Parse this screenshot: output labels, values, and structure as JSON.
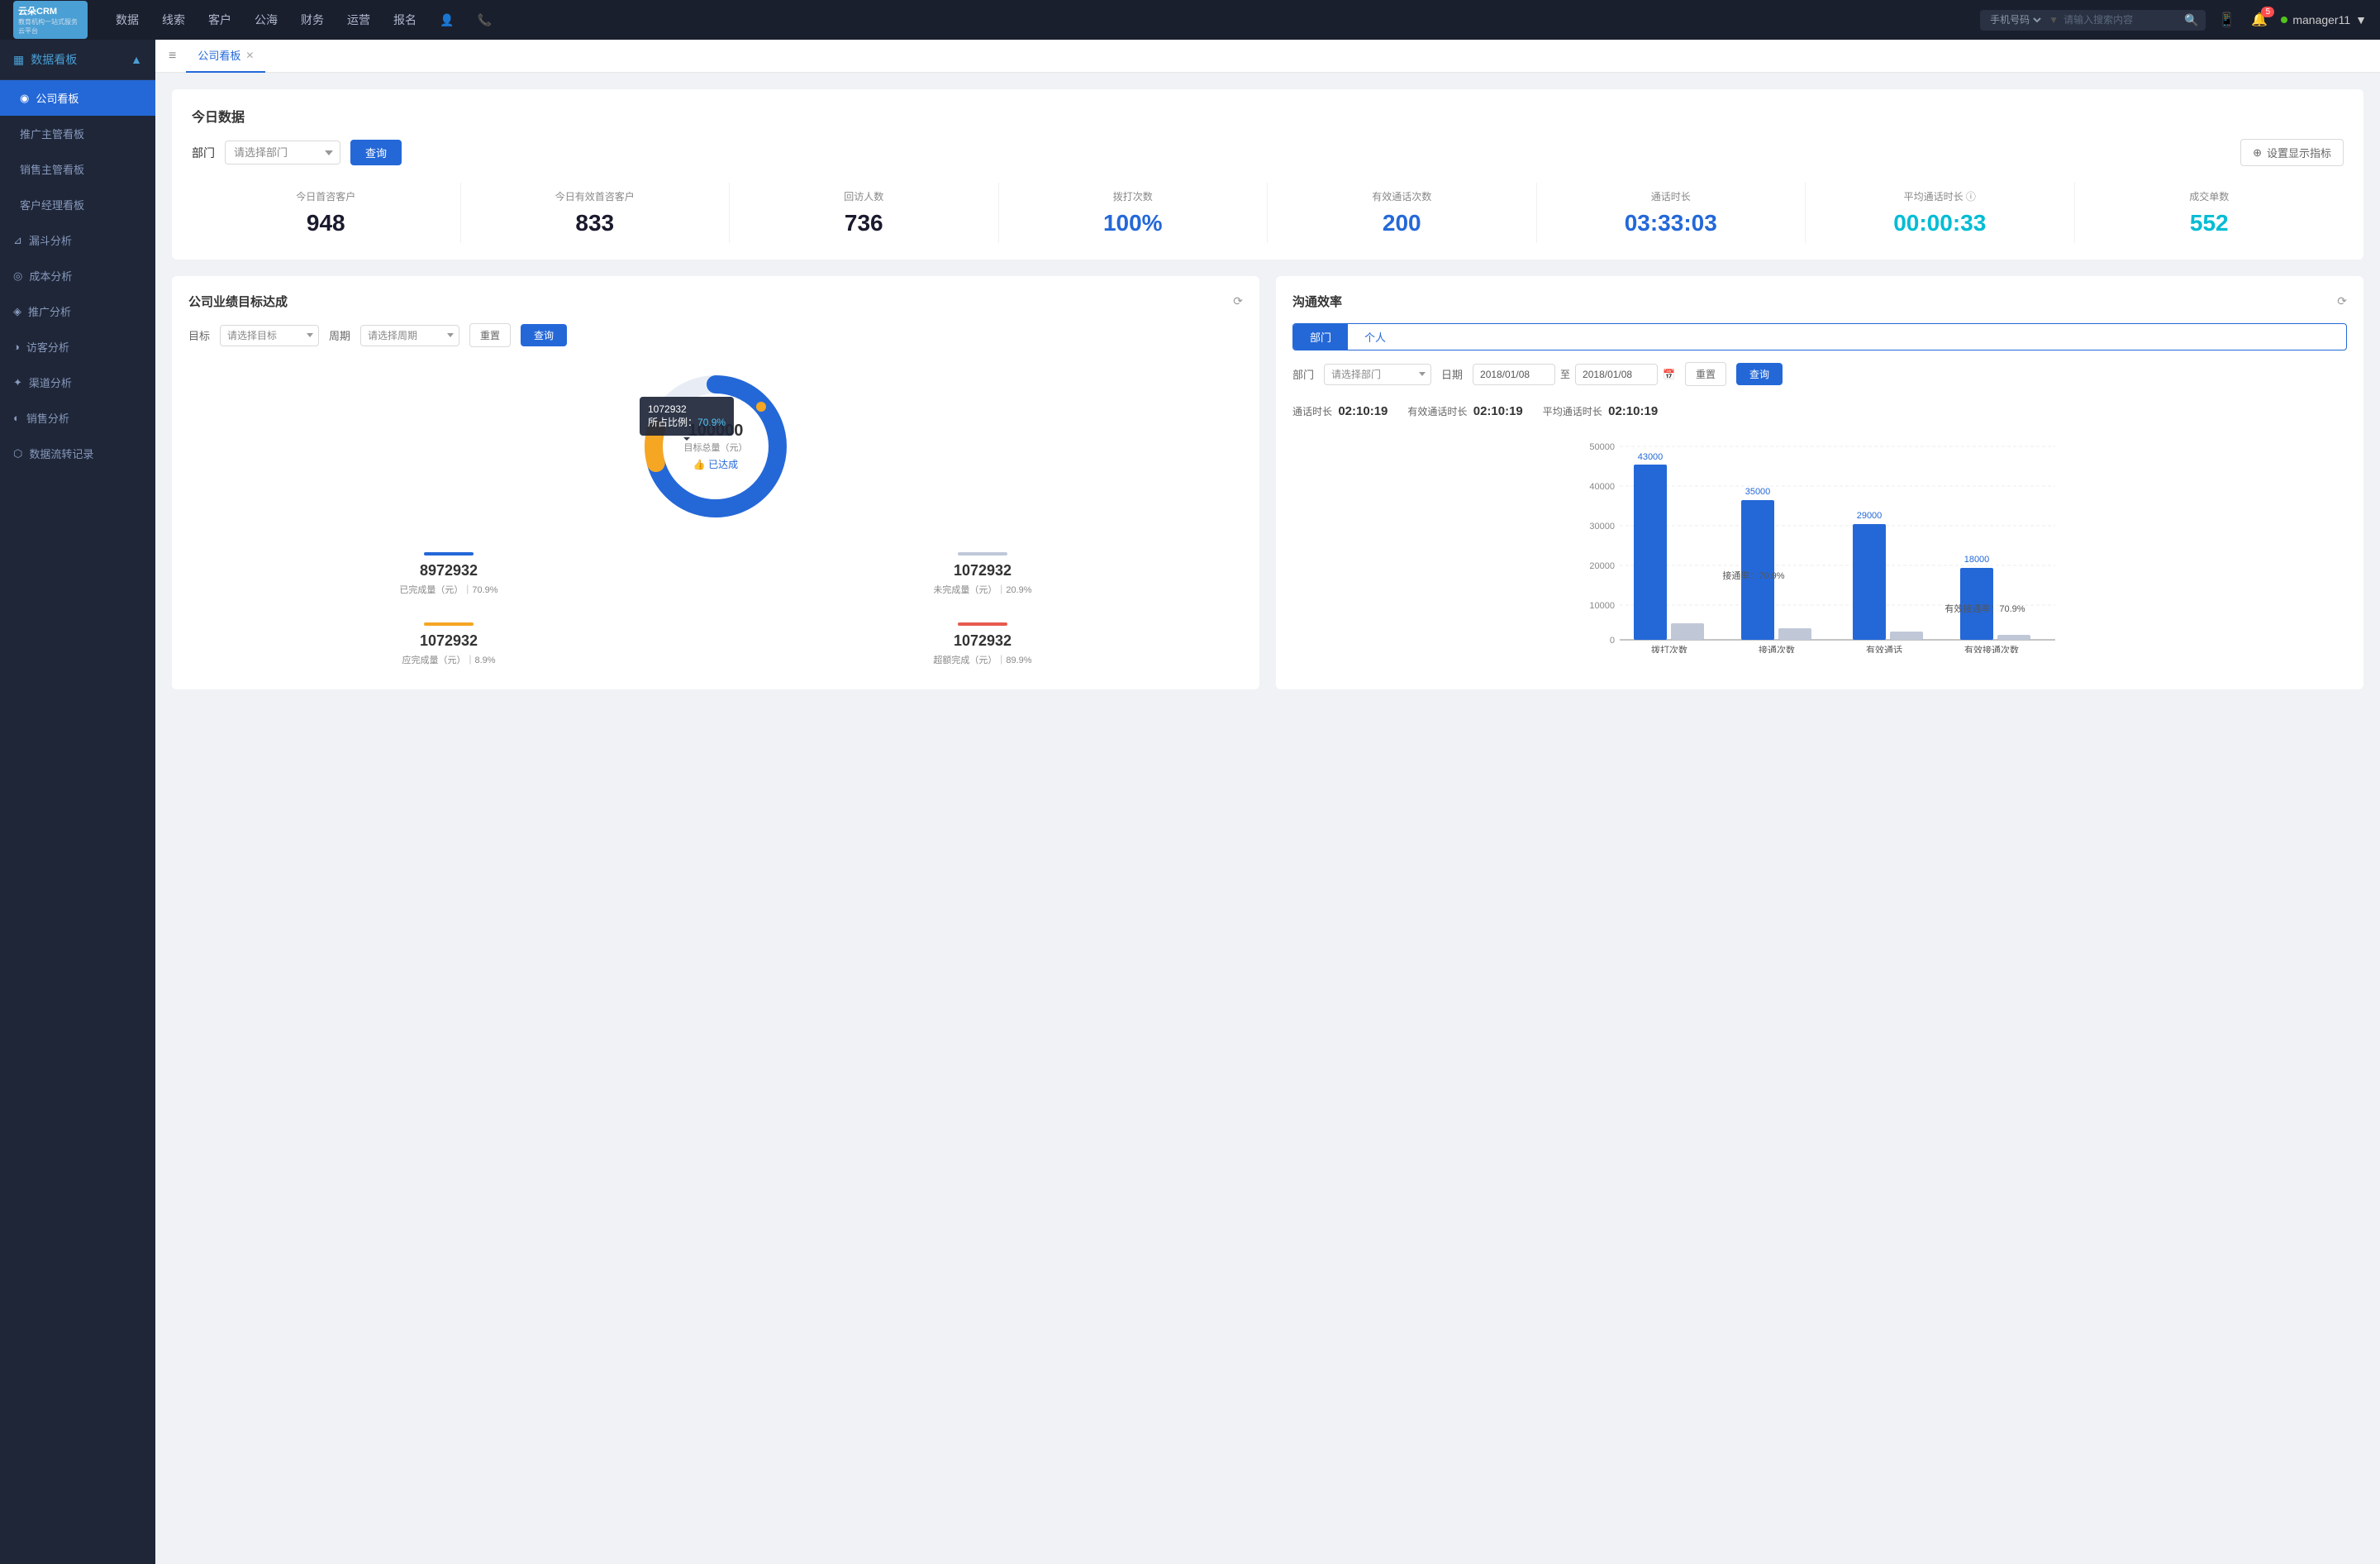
{
  "app": {
    "logo_top": "云朵CRM",
    "logo_bottom": "教育机构一站式服务云平台"
  },
  "nav": {
    "items": [
      "数据",
      "线索",
      "客户",
      "公海",
      "财务",
      "运营",
      "报名"
    ]
  },
  "search": {
    "placeholder": "请输入搜索内容",
    "option": "手机号码"
  },
  "user": {
    "name": "manager11",
    "notifications": "5"
  },
  "sidebar": {
    "header": "数据看板",
    "active_item": "公司看板",
    "items": [
      {
        "label": "公司看板",
        "active": true
      },
      {
        "label": "推广主管看板",
        "active": false
      },
      {
        "label": "销售主管看板",
        "active": false
      },
      {
        "label": "客户经理看板",
        "active": false
      }
    ],
    "groups": [
      {
        "label": "漏斗分析"
      },
      {
        "label": "成本分析"
      },
      {
        "label": "推广分析"
      },
      {
        "label": "访客分析"
      },
      {
        "label": "渠道分析"
      },
      {
        "label": "销售分析"
      },
      {
        "label": "数据流转记录"
      }
    ]
  },
  "tab": {
    "label": "公司看板"
  },
  "today_data": {
    "title": "今日数据",
    "filter_label": "部门",
    "filter_placeholder": "请选择部门",
    "query_btn": "查询",
    "settings_btn": "设置显示指标",
    "stats": [
      {
        "label": "今日首咨客户",
        "value": "948",
        "color": "dark"
      },
      {
        "label": "今日有效首咨客户",
        "value": "833",
        "color": "dark"
      },
      {
        "label": "回访人数",
        "value": "736",
        "color": "dark"
      },
      {
        "label": "拨打次数",
        "value": "100%",
        "color": "blue"
      },
      {
        "label": "有效通话次数",
        "value": "200",
        "color": "blue"
      },
      {
        "label": "通话时长",
        "value": "03:33:03",
        "color": "blue"
      },
      {
        "label": "平均通话时长",
        "value": "00:00:33",
        "color": "cyan"
      },
      {
        "label": "成交单数",
        "value": "552",
        "color": "cyan"
      }
    ]
  },
  "goal_panel": {
    "title": "公司业绩目标达成",
    "target_label": "目标",
    "target_placeholder": "请选择目标",
    "period_label": "周期",
    "period_placeholder": "请选择周期",
    "reset_btn": "重置",
    "query_btn": "查询",
    "donut": {
      "center_value": "100000",
      "center_sub": "目标总量（元）",
      "achieved_label": "👍 已达成",
      "tooltip_title": "1072932",
      "tooltip_ratio_label": "所占比例：",
      "tooltip_ratio": "70.9%"
    },
    "stats": [
      {
        "value": "8972932",
        "label": "已完成量（元）｜70.9%",
        "color": "#2468d8"
      },
      {
        "value": "1072932",
        "label": "未完成量（元）｜20.9%",
        "color": "#c0c8d8"
      },
      {
        "value": "1072932",
        "label": "应完成量（元）｜8.9%",
        "color": "#f5a623"
      },
      {
        "value": "1072932",
        "label": "超额完成（元）｜89.9%",
        "color": "#e85a4f"
      }
    ]
  },
  "comm_panel": {
    "title": "沟通效率",
    "tabs": [
      "部门",
      "个人"
    ],
    "active_tab": "部门",
    "dept_label": "部门",
    "dept_placeholder": "请选择部门",
    "date_label": "日期",
    "date_from": "2018/01/08",
    "date_to": "2018/01/08",
    "reset_btn": "重置",
    "query_btn": "查询",
    "comm_stats": [
      {
        "label": "通话时长",
        "value": "02:10:19"
      },
      {
        "label": "有效通话时长",
        "value": "02:10:19"
      },
      {
        "label": "平均通话时长",
        "value": "02:10:19"
      }
    ],
    "chart": {
      "y_labels": [
        "50000",
        "40000",
        "30000",
        "20000",
        "10000",
        "0"
      ],
      "groups": [
        {
          "label": "拨打次数",
          "bars": [
            {
              "value": 43000,
              "label": "43000",
              "color": "#2468d8"
            },
            {
              "value": 8000,
              "label": "",
              "color": "#c0c8d8"
            }
          ]
        },
        {
          "label": "接通次数",
          "rate_label": "接通率：70.9%",
          "bars": [
            {
              "value": 35000,
              "label": "35000",
              "color": "#2468d8"
            },
            {
              "value": 6000,
              "label": "",
              "color": "#c0c8d8"
            }
          ]
        },
        {
          "label": "有效通话",
          "bars": [
            {
              "value": 29000,
              "label": "29000",
              "color": "#2468d8"
            },
            {
              "value": 5000,
              "label": "",
              "color": "#c0c8d8"
            }
          ]
        },
        {
          "label": "有效接通次数",
          "rate_label": "有效接通率：70.9%",
          "bars": [
            {
              "value": 18000,
              "label": "18000",
              "color": "#2468d8"
            },
            {
              "value": 4000,
              "label": "",
              "color": "#c0c8d8"
            }
          ]
        }
      ]
    }
  }
}
